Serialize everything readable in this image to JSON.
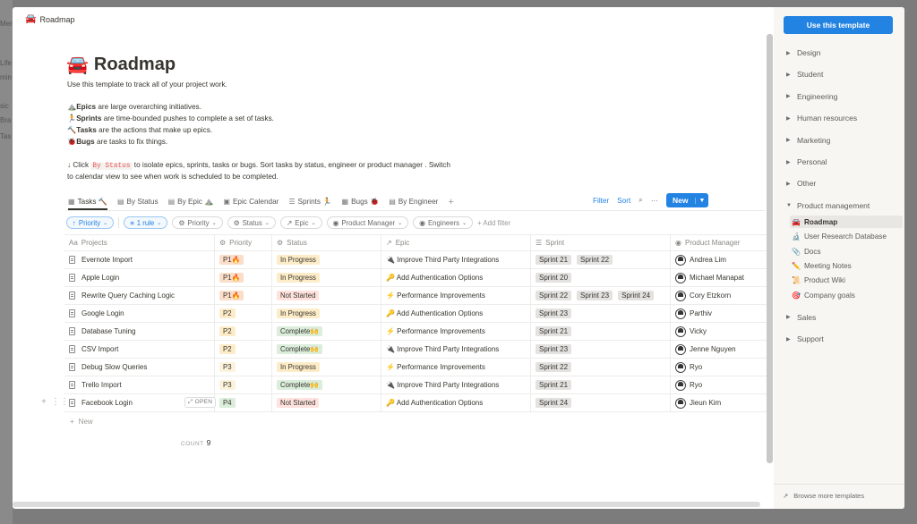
{
  "background_app": {
    "fragments": [
      "Men",
      "Life",
      "min",
      "sic",
      "Bra",
      "Tas"
    ]
  },
  "breadcrumb": {
    "icon": "car-icon",
    "label": "Roadmap"
  },
  "page": {
    "title": "Roadmap",
    "intro": "Use this template to track all of your project work.",
    "bullets": [
      {
        "icon": "mountain",
        "bold": "Epics",
        "rest": " are large overarching initiatives."
      },
      {
        "icon": "runner",
        "bold": "Sprints",
        "rest": " are time-bounded pushes to complete a set of tasks."
      },
      {
        "icon": "hammer",
        "bold": "Tasks",
        "rest": " are the actions that make up epics."
      },
      {
        "icon": "bug",
        "bold": "Bugs",
        "rest": " are tasks to fix things."
      }
    ],
    "hint_prefix": "↓ Click ",
    "hint_code": "By Status",
    "hint_line1_rest": " to isolate epics, sprints, tasks or bugs. Sort tasks by status, engineer or product manager . Switch",
    "hint_line2": "to calendar view to see when work is scheduled to be completed."
  },
  "views": {
    "tabs": [
      {
        "label": "Tasks 🔨",
        "icon": "table-icon",
        "active": true
      },
      {
        "label": "By Status",
        "icon": "board-icon"
      },
      {
        "label": "By Epic ⛰️",
        "icon": "board-icon"
      },
      {
        "label": "Epic Calendar",
        "icon": "calendar-icon"
      },
      {
        "label": "Sprints 🏃",
        "icon": "list-icon"
      },
      {
        "label": "Bugs 🐞",
        "icon": "table-icon"
      },
      {
        "label": "By Engineer",
        "icon": "board-icon"
      }
    ],
    "add": "+",
    "filter": "Filter",
    "sort": "Sort",
    "more": "···",
    "new": "New"
  },
  "filters": {
    "sort_chip": "Priority",
    "rule_chip": "1 rule",
    "props": [
      "Priority",
      "Status",
      "Epic",
      "Product Manager",
      "Engineers"
    ],
    "add": "Add filter"
  },
  "table": {
    "headers": [
      "Projects",
      "Priority",
      "Status",
      "Epic",
      "Sprint",
      "Product Manager"
    ],
    "rows": [
      {
        "name": "Evernote Import",
        "priority": "P1🔥",
        "pclass": "p1",
        "status": "In Progress",
        "sclass": "st-prog",
        "epic": "🔌 Improve Third Party Integrations",
        "sprints": [
          "Sprint 21",
          "Sprint 22"
        ],
        "pm": "Andrea Lim"
      },
      {
        "name": "Apple Login",
        "priority": "P1🔥",
        "pclass": "p1",
        "status": "In Progress",
        "sclass": "st-prog",
        "epic": "🔑 Add Authentication Options",
        "sprints": [
          "Sprint 20"
        ],
        "pm": "Michael Manapat"
      },
      {
        "name": "Rewrite Query Caching Logic",
        "priority": "P1🔥",
        "pclass": "p1",
        "status": "Not Started",
        "sclass": "st-not",
        "epic": "⚡ Performance Improvements",
        "sprints": [
          "Sprint 22",
          "Sprint 23",
          "Sprint 24"
        ],
        "pm": "Cory Etzkorn"
      },
      {
        "name": "Google Login",
        "priority": "P2",
        "pclass": "p2",
        "status": "In Progress",
        "sclass": "st-prog",
        "epic": "🔑 Add Authentication Options",
        "sprints": [
          "Sprint 23"
        ],
        "pm": "Parthiv"
      },
      {
        "name": "Database Tuning",
        "priority": "P2",
        "pclass": "p2",
        "status": "Complete🙌",
        "sclass": "st-done",
        "epic": "⚡ Performance Improvements",
        "sprints": [
          "Sprint 21"
        ],
        "pm": "Vicky"
      },
      {
        "name": "CSV Import",
        "priority": "P2",
        "pclass": "p2",
        "status": "Complete🙌",
        "sclass": "st-done",
        "epic": "🔌 Improve Third Party Integrations",
        "sprints": [
          "Sprint 23"
        ],
        "pm": "Jenne Nguyen"
      },
      {
        "name": "Debug Slow Queries",
        "priority": "P3",
        "pclass": "p3",
        "status": "In Progress",
        "sclass": "st-prog",
        "epic": "⚡ Performance Improvements",
        "sprints": [
          "Sprint 22"
        ],
        "pm": "Ryo"
      },
      {
        "name": "Trello Import",
        "priority": "P3",
        "pclass": "p3",
        "status": "Complete🙌",
        "sclass": "st-done",
        "epic": "🔌 Improve Third Party Integrations",
        "sprints": [
          "Sprint 21"
        ],
        "pm": "Ryo"
      },
      {
        "name": "Facebook Login",
        "priority": "P4",
        "pclass": "p4",
        "status": "Not Started",
        "sclass": "st-not",
        "epic": "🔑 Add Authentication Options",
        "sprints": [
          "Sprint 24"
        ],
        "pm": "Jieun Kim",
        "open": "OPEN"
      }
    ],
    "new_row": "New",
    "count_label": "COUNT",
    "count": "9"
  },
  "sidebar": {
    "use_button": "Use this template",
    "categories_top": [
      "Design",
      "Student",
      "Engineering",
      "Human resources",
      "Marketing",
      "Personal",
      "Other"
    ],
    "expanded": "Product management",
    "sub_items": [
      {
        "emoji": "🚘",
        "label": "Roadmap",
        "active": true
      },
      {
        "emoji": "🔬",
        "label": "User Research Database"
      },
      {
        "emoji": "📎",
        "label": "Docs"
      },
      {
        "emoji": "✏️",
        "label": "Meeting Notes"
      },
      {
        "emoji": "📜",
        "label": "Product Wiki"
      },
      {
        "emoji": "🎯",
        "label": "Company goals"
      }
    ],
    "categories_bottom": [
      "Sales",
      "Support"
    ],
    "browse": "Browse more templates"
  },
  "colors": {
    "accent": "#2383e2",
    "in_progress": "#fdecc8",
    "not_started": "#ffe2dd",
    "complete": "#dbeddb"
  }
}
